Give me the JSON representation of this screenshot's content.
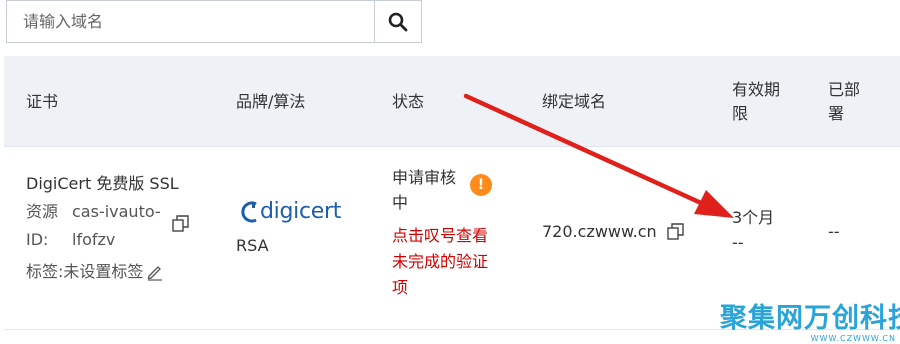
{
  "search": {
    "placeholder": "请输入域名",
    "icon": "search-icon"
  },
  "table": {
    "headers": {
      "cert": "证书",
      "brand": "品牌/算法",
      "status": "状态",
      "domain": "绑定域名",
      "validity_line1": "有效期",
      "validity_line2": "限",
      "deployed_line1": "已部",
      "deployed_line2": "署"
    },
    "row": {
      "cert_name": "DigiCert 免费版 SSL",
      "resource_label_1": "资源",
      "resource_label_2": "ID:",
      "resource_id_line1": "cas-ivauto-",
      "resource_id_line2": "lfofzv",
      "tag_label": "标签:未设置标签",
      "brand_logo_text": "digicert",
      "algorithm": "RSA",
      "status_line1": "申请审核",
      "status_line2": "中",
      "status_hint_line1": "点击叹号查看",
      "status_hint_line2": "未完成的验证",
      "status_hint_line3": "项",
      "bound_domain": "720.czwww.cn",
      "validity_line1": "3个月",
      "validity_line2": "--",
      "deployed": "--"
    }
  },
  "colors": {
    "header_bg": "#eef1f6",
    "link": "#1e5fa8",
    "warning": "#ff8c1a",
    "hint_red": "#d40000",
    "annotation_arrow": "#e0201b"
  },
  "watermark": {
    "brand_cn": "聚集网万创科技",
    "url": "WWW.CZWWW.CN"
  }
}
